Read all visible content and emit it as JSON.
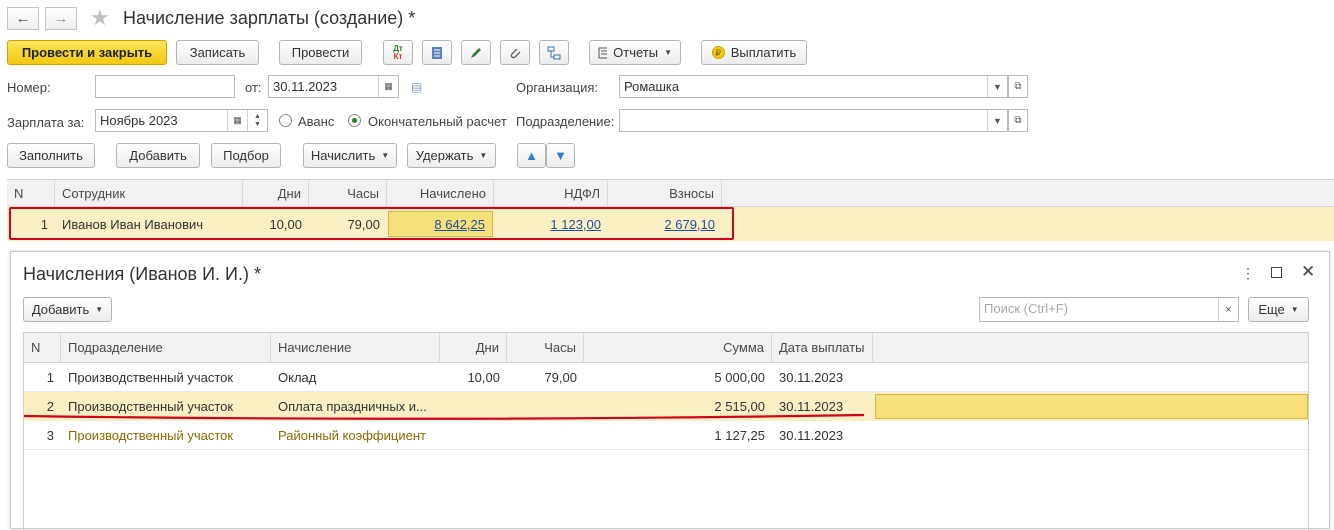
{
  "window": {
    "title": "Начисление зарплаты (создание) *"
  },
  "toolbar": {
    "post_close": "Провести и закрыть",
    "save": "Записать",
    "post": "Провести",
    "dtkt_top": "Дт",
    "dtkt_bottom": "Кт",
    "reports": "Отчеты",
    "pay": "Выплатить"
  },
  "form": {
    "number_label": "Номер:",
    "number_value": "",
    "date_label": "от:",
    "date_value": "30.11.2023",
    "org_label": "Организация:",
    "org_value": "Ромашка",
    "salary_for_label": "Зарплата за:",
    "salary_for_value": "Ноябрь 2023",
    "advance_label": "Аванс",
    "final_label": "Окончательный расчет",
    "dept_label": "Подразделение:",
    "dept_value": ""
  },
  "actions": {
    "fill": "Заполнить",
    "add": "Добавить",
    "pick": "Подбор",
    "accrue": "Начислить",
    "withhold": "Удержать"
  },
  "main_table": {
    "columns": [
      "N",
      "Сотрудник",
      "Дни",
      "Часы",
      "Начислено",
      "НДФЛ",
      "Взносы"
    ],
    "rows": [
      {
        "n": "1",
        "employee": "Иванов Иван Иванович",
        "days": "10,00",
        "hours": "79,00",
        "accrued": "8 642,25",
        "ndfl": "1 123,00",
        "contrib": "2 679,10"
      }
    ]
  },
  "subform": {
    "title": "Начисления (Иванов И. И.) *",
    "add": "Добавить",
    "search_placeholder": "Поиск (Ctrl+F)",
    "more": "Еще",
    "columns": [
      "N",
      "Подразделение",
      "Начисление",
      "Дни",
      "Часы",
      "Сумма",
      "Дата выплаты"
    ],
    "rows": [
      {
        "n": "1",
        "dept": "Производственный участок",
        "accrual": "Оклад",
        "days": "10,00",
        "hours": "79,00",
        "sum": "5 000,00",
        "date": "30.11.2023"
      },
      {
        "n": "2",
        "dept": "Производственный участок",
        "accrual": "Оплата праздничных и...",
        "days": "",
        "hours": "",
        "sum": "2 515,00",
        "date": "30.11.2023"
      },
      {
        "n": "3",
        "dept": "Производственный участок",
        "accrual": "Районный коэффициент",
        "days": "",
        "hours": "",
        "sum": "1 127,25",
        "date": "30.11.2023"
      }
    ]
  },
  "colors": {
    "accent_yellow": "#f2c811",
    "highlight_row": "#fbf0c4",
    "annotation_red": "#d0021b",
    "link": "#1f4fa0"
  }
}
